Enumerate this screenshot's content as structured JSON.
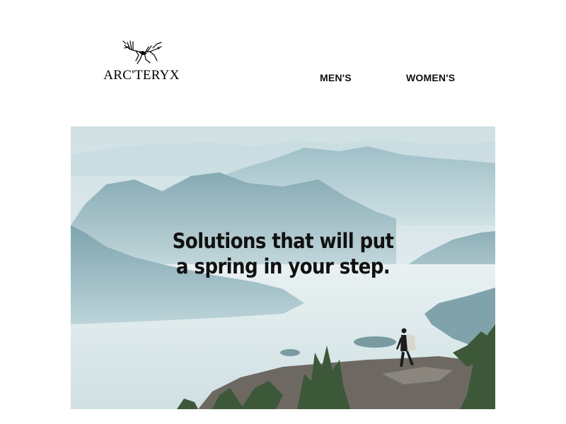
{
  "brand": {
    "name": "ARC'TERYX",
    "logo_icon": "archaeopteryx-fossil-icon"
  },
  "nav": {
    "items": [
      {
        "label": "MEN'S"
      },
      {
        "label": "WOMEN'S"
      }
    ]
  },
  "hero": {
    "headline_line1": "Solutions that will put",
    "headline_line2": "a spring in your step.",
    "image": "hiker-on-mountain-ridge-over-misty-fjord",
    "colors": {
      "sky": "#d9e8ec",
      "mountains_far": "#b6d0d6",
      "mountains_near": "#8fb2ba",
      "water": "#e6f0f1",
      "rock": "#6f6a63",
      "trees": "#3f5a3a",
      "text": "#111111"
    }
  }
}
